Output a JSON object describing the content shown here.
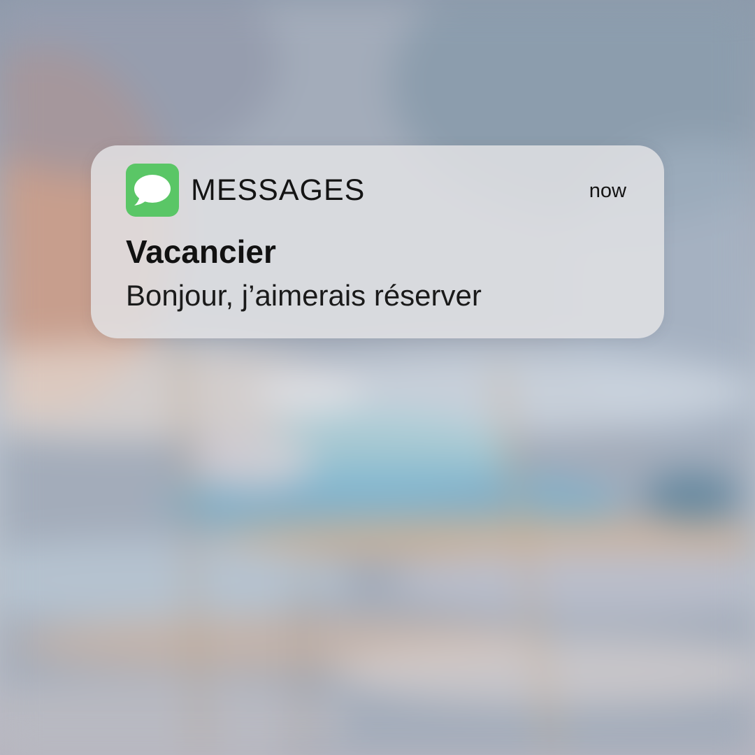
{
  "notification": {
    "app_name": "MESSAGES",
    "app_icon": "messages-bubble-icon",
    "timestamp": "now",
    "sender": "Vacancier",
    "body": "Bonjour, j’aimerais réserver"
  },
  "colors": {
    "app_icon_green": "#5ac666",
    "notification_background": "#e2e2e5",
    "text": "#141414"
  }
}
